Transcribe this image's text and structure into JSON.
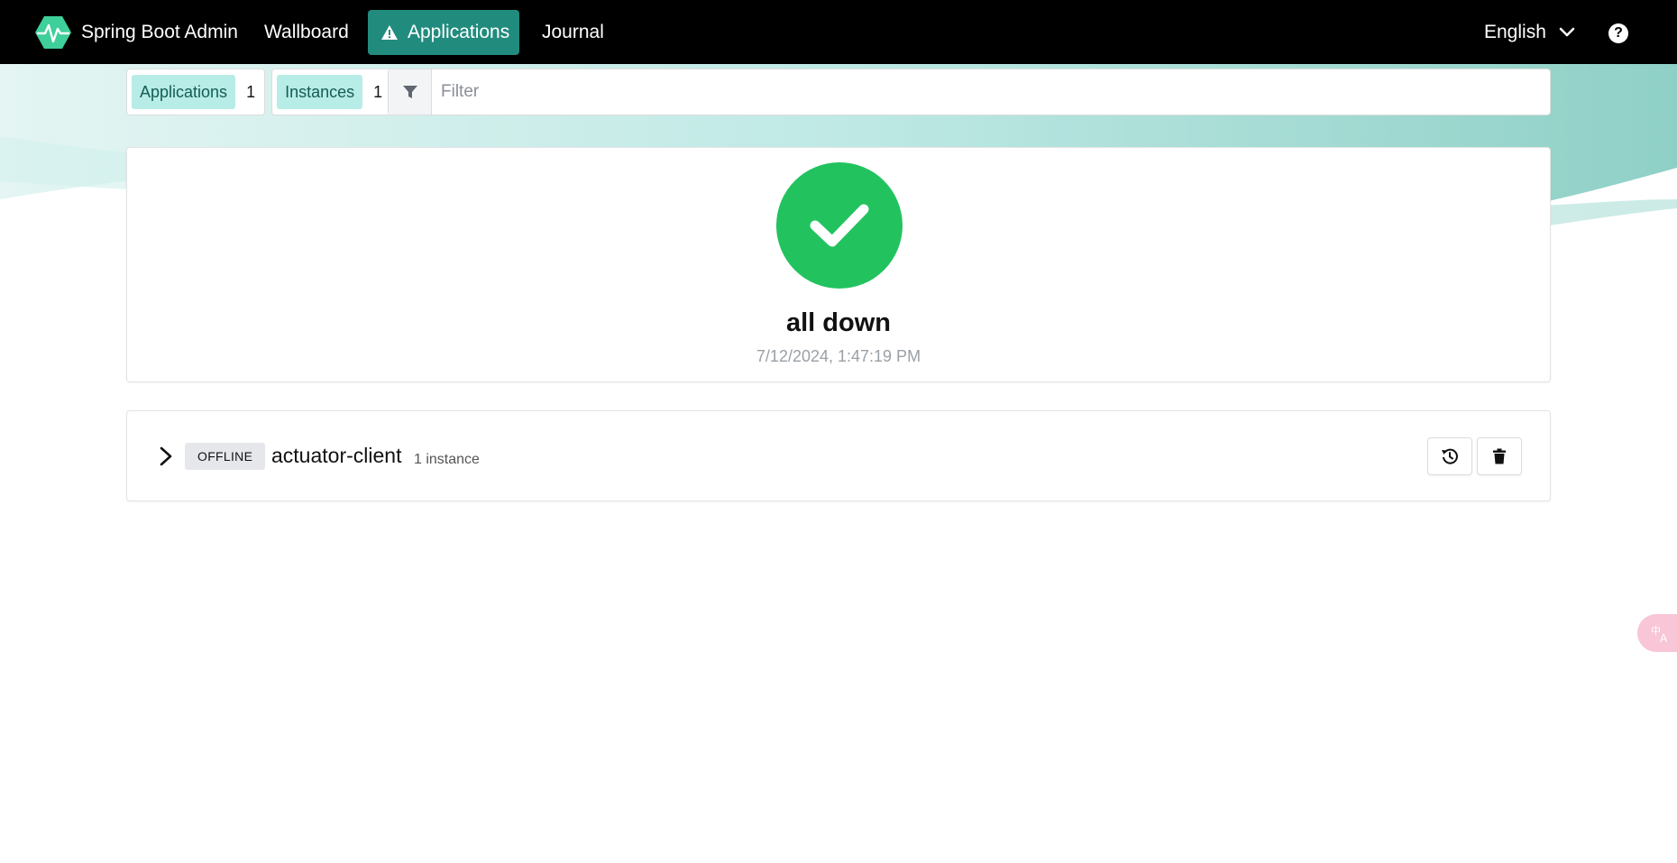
{
  "header": {
    "brand": "Spring Boot Admin",
    "nav": [
      {
        "label": "Wallboard"
      },
      {
        "label": "Applications",
        "active": true,
        "icon": "warning-icon"
      },
      {
        "label": "Journal"
      }
    ],
    "language": "English",
    "help_icon": "?"
  },
  "filter": {
    "applications_label": "Applications",
    "applications_count": "1",
    "instances_label": "Instances",
    "instances_count": "1",
    "placeholder": "Filter"
  },
  "status": {
    "title": "all down",
    "timestamp": "7/12/2024, 1:47:19 PM",
    "color": "#22c35f"
  },
  "applications": [
    {
      "status": "OFFLINE",
      "name": "actuator-client",
      "instances": "1 instance"
    }
  ],
  "colors": {
    "accent": "#218c7e",
    "chip": "#b8ece6",
    "topbar": "#000000"
  }
}
